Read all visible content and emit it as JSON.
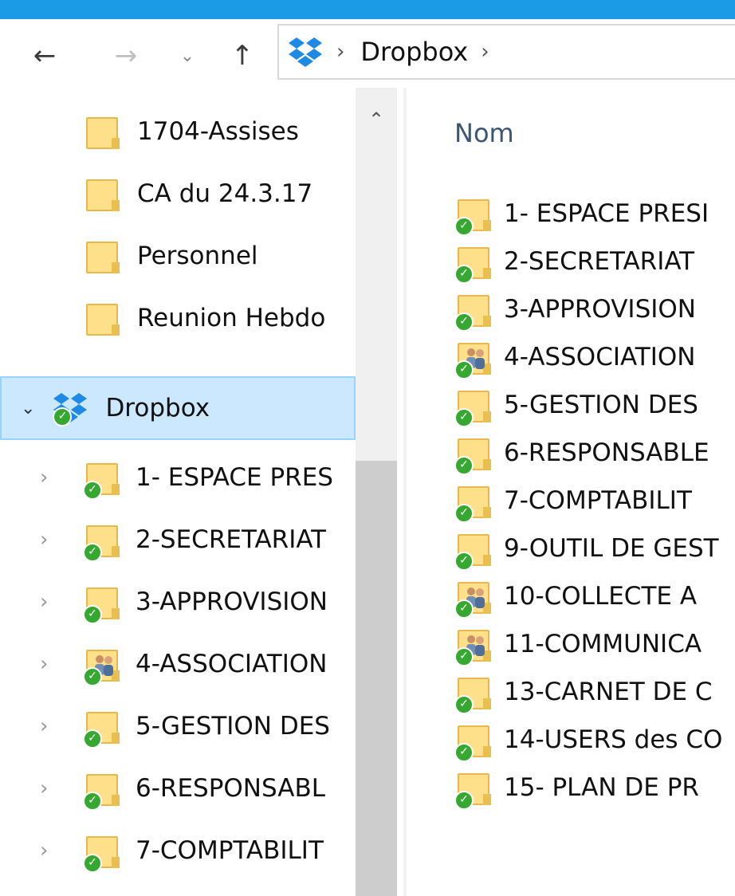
{
  "window": {
    "accent_color": "#1b9ae6",
    "selection_color": "#cce8ff"
  },
  "nav_bar": {
    "back_icon": "←",
    "forward_icon": "→",
    "recent_icon": "⌄",
    "up_icon": "↑",
    "breadcrumb": {
      "root_sep": "›",
      "items": [
        "Dropbox"
      ],
      "trailing_sep": "›"
    }
  },
  "nav_pane": {
    "folders": [
      {
        "label": "1704-Assises"
      },
      {
        "label": "CA du 24.3.17"
      },
      {
        "label": "Personnel"
      },
      {
        "label": "Reunion Hebdo"
      }
    ],
    "dropbox_root": {
      "label": "Dropbox",
      "expander": "⌄"
    },
    "dropbox_children": [
      {
        "label": "1- ESPACE PRES",
        "shared": false
      },
      {
        "label": "2-SECRETARIAT",
        "shared": false
      },
      {
        "label": "3-APPROVISION",
        "shared": false
      },
      {
        "label": "4-ASSOCIATION",
        "shared": true
      },
      {
        "label": "5-GESTION DES",
        "shared": false
      },
      {
        "label": "6-RESPONSABL",
        "shared": false
      },
      {
        "label": "7-COMPTABILIT",
        "shared": false
      }
    ],
    "child_expander": "›",
    "scroll_up_icon": "⌃"
  },
  "content": {
    "column_header": "Nom",
    "items": [
      {
        "label": "1- ESPACE PRESI",
        "shared": false
      },
      {
        "label": "2-SECRETARIAT",
        "shared": false
      },
      {
        "label": "3-APPROVISION",
        "shared": false
      },
      {
        "label": "4-ASSOCIATION",
        "shared": true
      },
      {
        "label": "5-GESTION DES",
        "shared": false
      },
      {
        "label": "6-RESPONSABLE",
        "shared": false
      },
      {
        "label": "7-COMPTABILIT",
        "shared": false
      },
      {
        "label": "9-OUTIL DE GEST",
        "shared": false
      },
      {
        "label": "10-COLLECTE A",
        "shared": true
      },
      {
        "label": "11-COMMUNICA",
        "shared": true
      },
      {
        "label": "13-CARNET DE C",
        "shared": false
      },
      {
        "label": "14-USERS des CO",
        "shared": false
      },
      {
        "label": "15- PLAN DE PR",
        "shared": false
      }
    ]
  }
}
